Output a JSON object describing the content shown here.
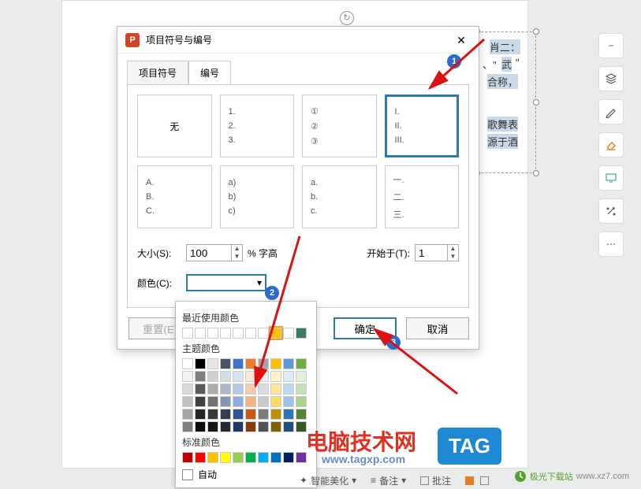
{
  "dialog": {
    "title": "项目符号与编号",
    "icon_letter": "P",
    "tabs": {
      "bullets": "项目符号",
      "numbering": "编号"
    },
    "none_label": "无",
    "grid": [
      [
        "1.",
        "2.",
        "3."
      ],
      [
        "①",
        "②",
        "③"
      ],
      [
        "I.",
        "II.",
        "III."
      ],
      [
        "A.",
        "B.",
        "C."
      ],
      [
        "a)",
        "b)",
        "c)"
      ],
      [
        "a.",
        "b.",
        "c."
      ],
      [
        "一.",
        "二.",
        "三."
      ]
    ],
    "size_label": "大小(S):",
    "size_value": "100",
    "size_suffix": "% 字高",
    "start_label": "开始于(T):",
    "start_value": "1",
    "color_label": "颜色(C):",
    "reset_btn": "重置(E)",
    "ok_btn": "确定",
    "cancel_btn": "取消"
  },
  "annotations": {
    "n1": "1",
    "n2": "2",
    "n3": "3"
  },
  "color_panel": {
    "recent_label": "最近使用颜色",
    "recent": [
      "#ffffff",
      "#ffffff",
      "#ffffff",
      "#ffffff",
      "#ffffff",
      "#ffffff",
      "#ffffff",
      "#ffc000",
      "#ffffff",
      "#3b7a6a"
    ],
    "theme_label": "主题颜色",
    "theme_row1": [
      "#ffffff",
      "#000000",
      "#e7e6e6",
      "#44546a",
      "#4472c4",
      "#ed7d31",
      "#a5a5a5",
      "#ffc000",
      "#5b9bd5",
      "#70ad47"
    ],
    "theme_grid": [
      [
        "#f2f2f2",
        "#7f7f7f",
        "#d0cece",
        "#d6dce5",
        "#d9e2f3",
        "#fbe5d6",
        "#ededed",
        "#fff2cc",
        "#deebf7",
        "#e2f0d9"
      ],
      [
        "#d9d9d9",
        "#595959",
        "#aeabab",
        "#adb9ca",
        "#b4c7e7",
        "#f7cbac",
        "#dbdbdb",
        "#ffe699",
        "#bdd7ee",
        "#c5e0b4"
      ],
      [
        "#bfbfbf",
        "#404040",
        "#757070",
        "#8497b0",
        "#8faadc",
        "#f4b183",
        "#c9c9c9",
        "#ffd966",
        "#9dc3e6",
        "#a9d18e"
      ],
      [
        "#a6a6a6",
        "#262626",
        "#3b3838",
        "#333f50",
        "#2f5597",
        "#c55a11",
        "#7b7b7b",
        "#bf9000",
        "#2e75b6",
        "#548235"
      ],
      [
        "#808080",
        "#0d0d0d",
        "#171616",
        "#222a35",
        "#1f3864",
        "#843c0c",
        "#525252",
        "#806000",
        "#1e4e79",
        "#385723"
      ]
    ],
    "standard_label": "标准颜色",
    "standard": [
      "#c00000",
      "#ff0000",
      "#ffc000",
      "#ffff00",
      "#92d050",
      "#00b050",
      "#00b0f0",
      "#0070c0",
      "#002060",
      "#7030a0"
    ],
    "auto_label": "自动"
  },
  "background_text": {
    "t1": "肖二：",
    "t2": "、\"",
    "t3": "武",
    "t4": "\"",
    "t5": "合称，",
    "t6": "歌舞表",
    "t7": "源于酒"
  },
  "tools": {
    "minus": "−",
    "layers": "layers-icon",
    "pen": "pen-icon",
    "eraser": "eraser-icon",
    "screen": "screen-icon",
    "wand": "wand-icon",
    "dots": "⋯"
  },
  "status": {
    "beautify": "智能美化",
    "notes": "备注",
    "review": "批注"
  },
  "watermarks": {
    "w1": "电脑技术网",
    "w2": "www.tagxp.com",
    "tag": "TAG",
    "site_name": "极光下载站",
    "site_url": "www.xz7.com"
  }
}
